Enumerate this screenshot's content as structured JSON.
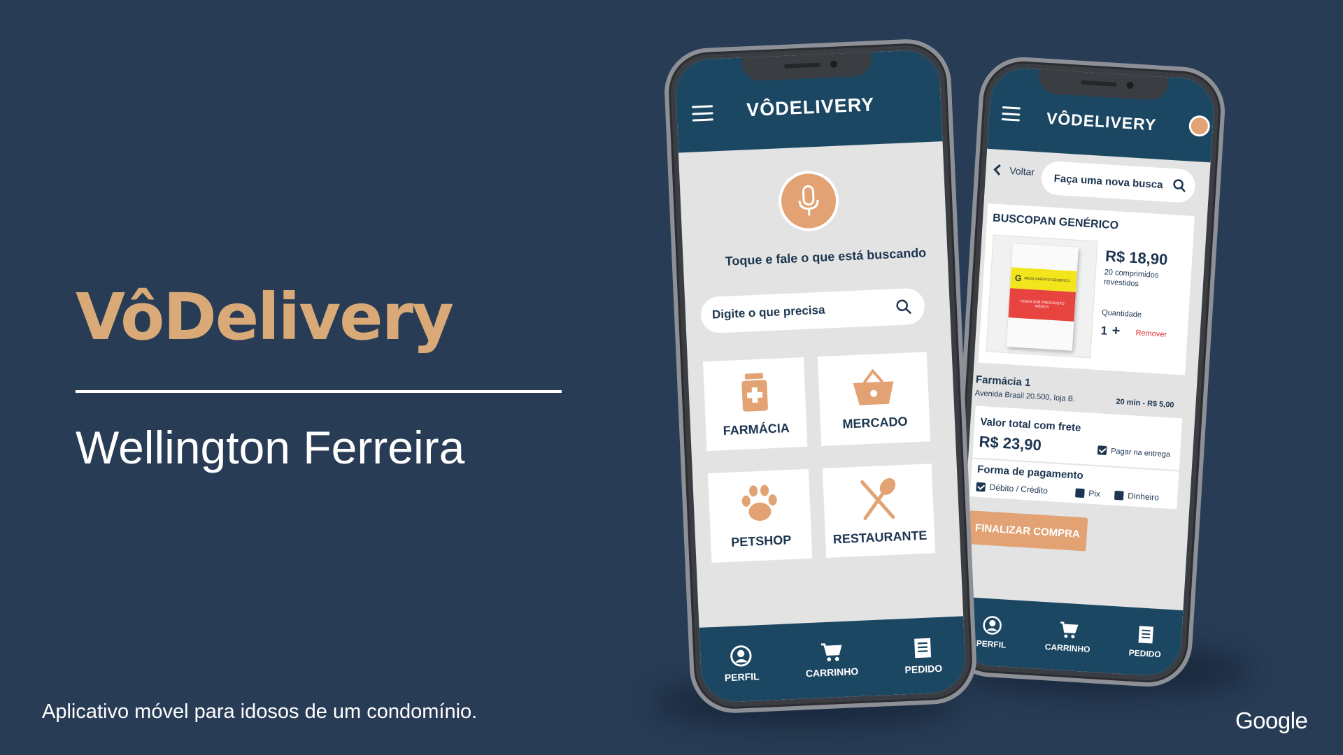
{
  "slide": {
    "title": "VôDelivery",
    "author": "Wellington Ferreira",
    "caption": "Aplicativo móvel para idosos de um condomínio.",
    "logo_text": "Google"
  },
  "colors": {
    "background": "#283c55",
    "accent": "#d9aa78",
    "app_primary": "#1c4763",
    "app_accent": "#e2a273"
  },
  "front_phone": {
    "brand": "VÔDELIVERY",
    "voice_prompt": "Toque e fale o que está buscando",
    "search_placeholder": "Digite o que precisa",
    "categories": [
      {
        "label": "FARMÁCIA",
        "icon": "pharmacy-icon"
      },
      {
        "label": "MERCADO",
        "icon": "basket-icon"
      },
      {
        "label": "PETSHOP",
        "icon": "paw-icon"
      },
      {
        "label": "RESTAURANTE",
        "icon": "utensils-icon"
      }
    ],
    "nav": [
      {
        "label": "PERFIL",
        "icon": "user-icon"
      },
      {
        "label": "CARRINHO",
        "icon": "cart-icon"
      },
      {
        "label": "PEDIDO",
        "icon": "receipt-icon"
      }
    ]
  },
  "back_phone": {
    "brand": "VÔDELIVERY",
    "back_label": "Voltar",
    "search_placeholder": "Faça uma nova busca",
    "product": {
      "name": "BUSCOPAN GENÉRICO",
      "price": "R$ 18,90",
      "description_line1": "20 comprimidos",
      "description_line2": "revestidos",
      "quantity_label": "Quantidade",
      "quantity": "1",
      "remove_label": "Remover",
      "box_badge": "G",
      "box_text_top": "MEDICAMENTO GENÉRICO",
      "box_text_bottom": "VENDA SOB PRESCRIÇÃO MÉDICA"
    },
    "store": {
      "name": "Farmácia 1",
      "address": "Avenida Brasil 20.500, loja B.",
      "eta": "20 min - R$ 5,00"
    },
    "total": {
      "label": "Valor total com frete",
      "value": "R$ 23,90",
      "pay_on_delivery": "Pagar na entrega"
    },
    "payment": {
      "title": "Forma de pagamento",
      "options": [
        "Débito / Crédito",
        "Pix",
        "Dinheiro"
      ]
    },
    "finalize_label": "FINALIZAR COMPRA",
    "nav": [
      {
        "label": "PERFIL",
        "icon": "user-icon"
      },
      {
        "label": "CARRINHO",
        "icon": "cart-icon"
      },
      {
        "label": "PEDIDO",
        "icon": "receipt-icon"
      }
    ]
  }
}
